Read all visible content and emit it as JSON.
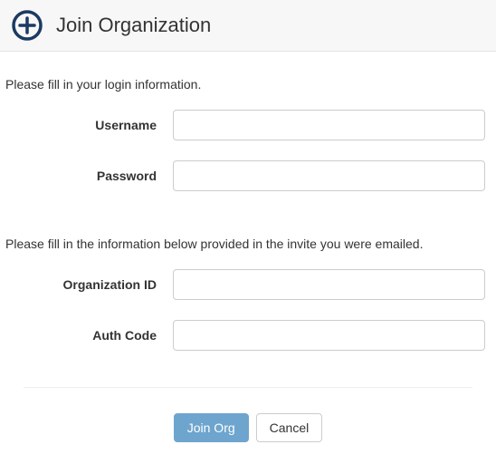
{
  "header": {
    "title": "Join Organization"
  },
  "section1": {
    "description": "Please fill in your login information.",
    "fields": {
      "username": {
        "label": "Username",
        "value": ""
      },
      "password": {
        "label": "Password",
        "value": ""
      }
    }
  },
  "section2": {
    "description": "Please fill in the information below provided in the invite you were emailed.",
    "fields": {
      "org_id": {
        "label": "Organization ID",
        "value": ""
      },
      "auth_code": {
        "label": "Auth Code",
        "value": ""
      }
    }
  },
  "footer": {
    "join_label": "Join Org",
    "cancel_label": "Cancel"
  }
}
